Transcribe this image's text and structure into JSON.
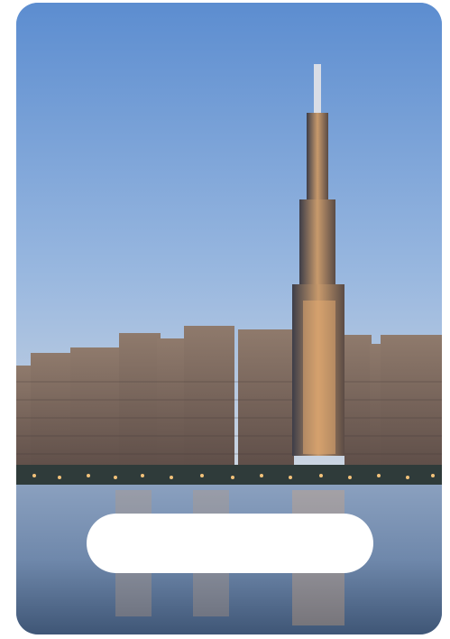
{
  "card": {
    "image_description_icon": "city-skyline-photo",
    "input": {
      "value": "",
      "placeholder": ""
    }
  },
  "colors": {
    "sky_top": "#5f8fd0",
    "sky_bottom": "#c9d6e6",
    "water": "#6d89ad",
    "pill": "#ffffff",
    "building": "#7a6a5e",
    "lights": "#f2c27a"
  }
}
